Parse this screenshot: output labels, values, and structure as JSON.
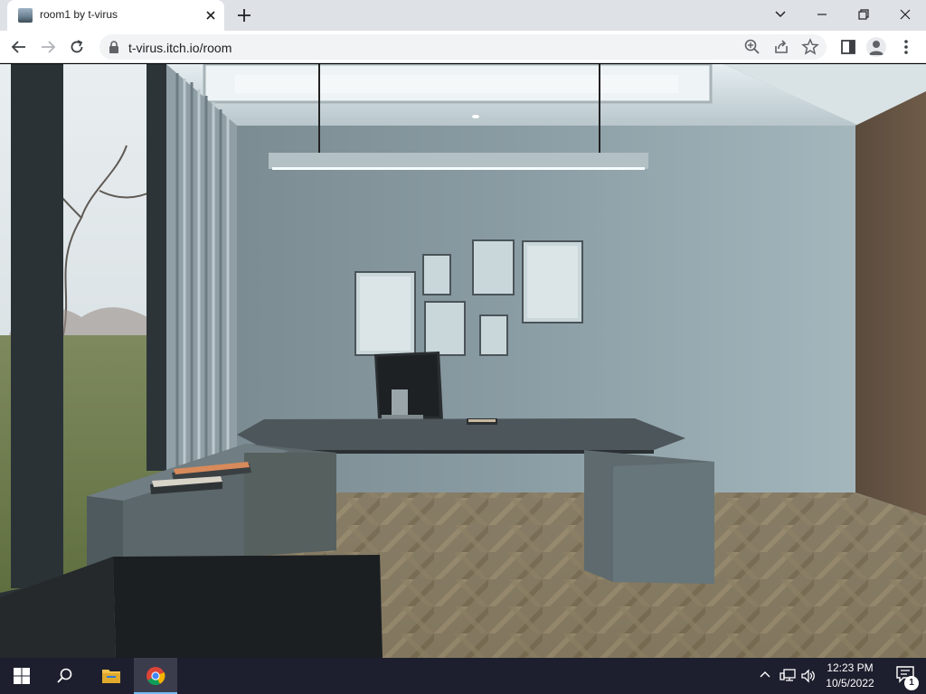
{
  "browser": {
    "tab_title": "room1 by t-virus",
    "url": "t-virus.itch.io/room",
    "icons": {
      "favicon": "itch-game-thumbnail-icon",
      "close": "close-icon",
      "new_tab": "plus-icon",
      "tab_search": "chevron-down-icon",
      "minimize": "minimize-icon",
      "restore": "restore-icon",
      "window_close": "close-icon",
      "back": "back-arrow-icon",
      "forward": "forward-arrow-icon",
      "reload": "reload-icon",
      "lock": "lock-icon",
      "zoom": "zoom-icon",
      "share": "share-icon",
      "bookmark": "star-icon",
      "side_panel": "side-panel-icon",
      "profile": "profile-icon",
      "menu": "kebab-menu-icon"
    }
  },
  "game": {
    "scene": "3D office room with large window, pendant lamp, wall picture frames, L-shaped desk with monitor and books, herringbone wood floor"
  },
  "taskbar": {
    "apps": [
      "start-icon",
      "search-icon",
      "file-explorer-icon",
      "chrome-icon"
    ],
    "active_app": "chrome",
    "time": "12:23 PM",
    "date": "10/5/2022",
    "notification_count": "1",
    "accent_color": "#76b9ed"
  }
}
